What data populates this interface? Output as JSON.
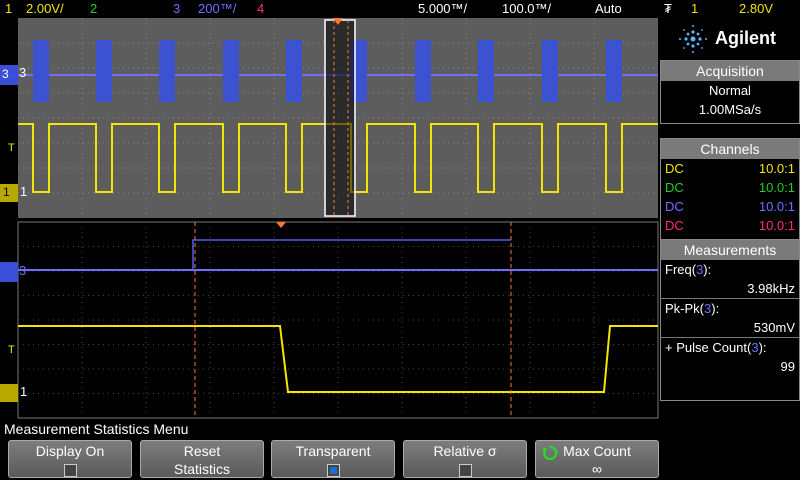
{
  "topbar": {
    "ch1_num": "1",
    "ch1_scale": "2.00V/",
    "ch2_num": "2",
    "ch3_num": "3",
    "ch3_scale": "200™/",
    "ch4_num": "4",
    "timebase": "5.000™/",
    "zoom_base": "100.0™/",
    "trigger_mode": "Auto",
    "trigger_icon": "₮",
    "trigger_ch": "1",
    "trigger_level": "2.80V",
    "colors": {
      "ch1": "#f2e600",
      "ch2": "#20d020",
      "ch3": "#6f6fff",
      "ch4": "#ff3070"
    }
  },
  "traces": {
    "ch3_label": "3",
    "ch1_label": "1",
    "trigger_marker": "T"
  },
  "panel": {
    "brand": "Agilent",
    "acquisition": {
      "title": "Acquisition",
      "mode": "Normal",
      "rate": "1.00MSa/s"
    },
    "channels": {
      "title": "Channels",
      "rows": [
        {
          "coupling": "DC",
          "probe": "10.0:1",
          "color": "#f2e600"
        },
        {
          "coupling": "DC",
          "probe": "10.0:1",
          "color": "#20d020"
        },
        {
          "coupling": "DC",
          "probe": "10.0:1",
          "color": "#6f6fff"
        },
        {
          "coupling": "DC",
          "probe": "10.0:1",
          "color": "#ff3070"
        }
      ]
    },
    "measurements": {
      "title": "Measurements",
      "items": [
        {
          "name": "Freq(",
          "ch": "3",
          "close": "):",
          "value": "3.98kHz"
        },
        {
          "name": "Pk-Pk(",
          "ch": "3",
          "close": "):",
          "value": "530mV"
        },
        {
          "name": "+ Pulse Count(",
          "ch": "3",
          "close": "):",
          "value": "99"
        }
      ]
    }
  },
  "menu": {
    "title": "Measurement Statistics Menu",
    "softkeys": [
      {
        "line1": "Display On",
        "checked": false
      },
      {
        "line1": "Reset",
        "line2": "Statistics"
      },
      {
        "line1": "Transparent",
        "checked": true
      },
      {
        "line1": "Relative σ",
        "checked": false
      },
      {
        "icon": "rotate-knob-icon",
        "line1": "Max Count",
        "line2": "∞"
      }
    ]
  }
}
